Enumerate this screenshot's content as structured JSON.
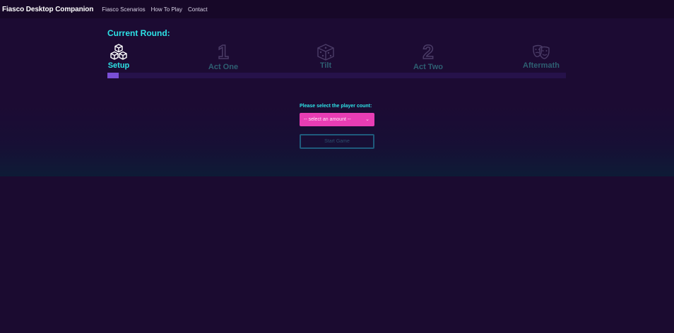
{
  "navbar": {
    "brand": "Fiasco Desktop Companion",
    "links": [
      "Fiasco Scenarios",
      "How To Play",
      "Contact"
    ]
  },
  "round": {
    "title": "Current Round:",
    "steps": [
      {
        "label": "Setup",
        "icon": "cubes-icon",
        "active": true
      },
      {
        "label": "Act One",
        "icon": "number-1-icon",
        "glyph": "1",
        "active": false
      },
      {
        "label": "Tilt",
        "icon": "dice-icon",
        "active": false
      },
      {
        "label": "Act Two",
        "icon": "number-2-icon",
        "glyph": "2",
        "active": false
      },
      {
        "label": "Aftermath",
        "icon": "theater-masks-icon",
        "active": false
      }
    ],
    "progress_percent": 2.5
  },
  "setup": {
    "player_count_label": "Please select the player count:",
    "select_value": "-- select an amount --",
    "start_label": "Start Game"
  },
  "colors": {
    "background": "#1b0b30",
    "accent_cyan": "#2de2e6",
    "select_pink": "#e83db4",
    "progress_purple": "#7a4fd6"
  }
}
